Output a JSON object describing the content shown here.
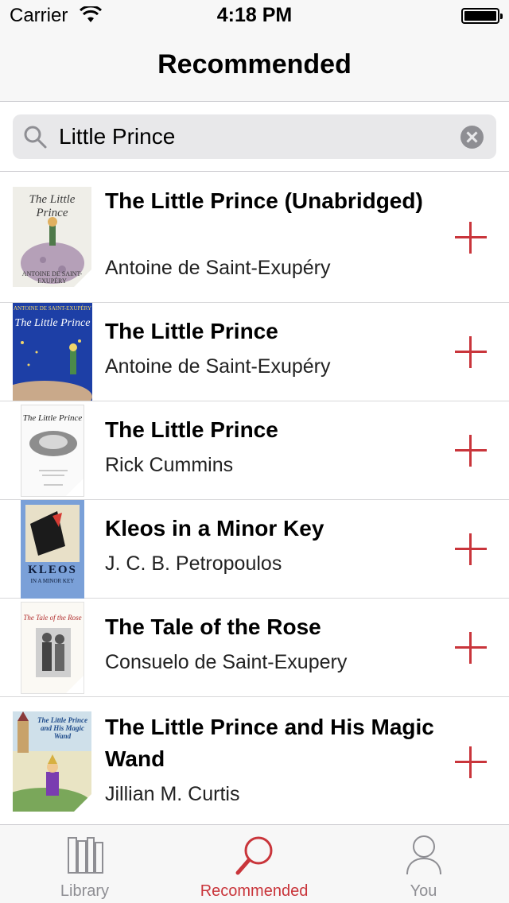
{
  "status_bar": {
    "carrier": "Carrier",
    "time": "4:18 PM"
  },
  "nav": {
    "title": "Recommended"
  },
  "search": {
    "value": "Little Prince"
  },
  "books": [
    {
      "title": "The Little Prince (Unabridged)",
      "author": "Antoine de Saint-Exupéry",
      "cover_text": "The Little Prince",
      "cover_footer": "ANTOINE DE SAINT-EXUPÉRY"
    },
    {
      "title": "The Little Prince",
      "author": "Antoine de Saint-Exupéry",
      "cover_header": "ANTOINE DE SAINT-EXUPÉRY",
      "cover_text": "The Little Prince"
    },
    {
      "title": "The Little Prince",
      "author": "Rick Cummins",
      "cover_text": "The Little Prince"
    },
    {
      "title": "Kleos in a Minor Key",
      "author": "J. C. B. Petropoulos",
      "cover_text": "KLEOS",
      "cover_sub": "IN A MINOR KEY"
    },
    {
      "title": "The Tale of the Rose",
      "author": "Consuelo de Saint-Exupery",
      "cover_text": "The Tale of the Rose"
    },
    {
      "title": "The Little Prince and His Magic Wand",
      "author": "Jillian M. Curtis",
      "cover_text": "The Little Prince and His Magic Wand"
    }
  ],
  "tabs": [
    {
      "label": "Library",
      "icon": "books-icon",
      "active": false
    },
    {
      "label": "Recommended",
      "icon": "magnifier-icon",
      "active": true
    },
    {
      "label": "You",
      "icon": "person-icon",
      "active": false
    }
  ],
  "colors": {
    "accent": "#c9353b",
    "inactive": "#8e8e93",
    "bar_bg": "#f7f7f7"
  }
}
